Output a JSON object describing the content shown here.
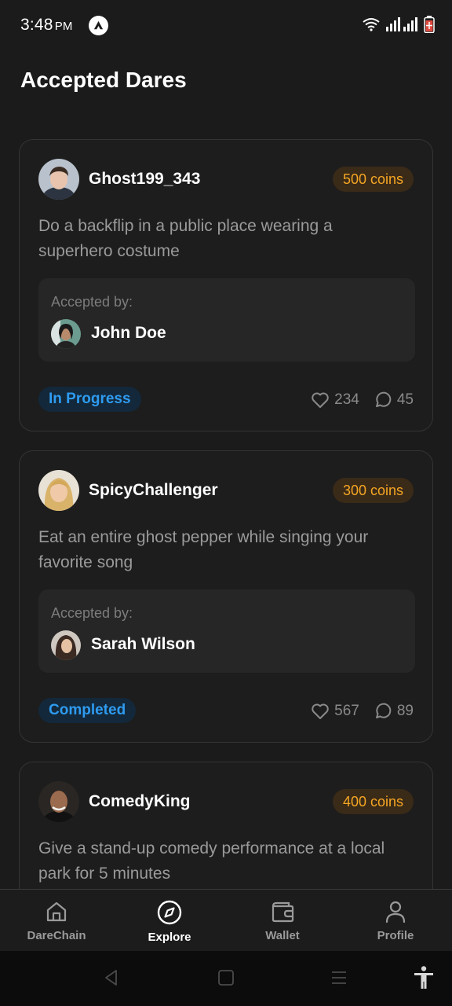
{
  "status_bar": {
    "time": "3:48",
    "ampm": "PM"
  },
  "page_title": "Accepted Dares",
  "cards": [
    {
      "username": "Ghost199_343",
      "coins": "500 coins",
      "description": "Do a backflip in a public place wearing a superhero costume",
      "accepted_label": "Accepted by:",
      "accepted_by": "John Doe",
      "status": "In Progress",
      "likes": "234",
      "comments": "45"
    },
    {
      "username": "SpicyChallenger",
      "coins": "300 coins",
      "description": "Eat an entire ghost pepper while singing your favorite song",
      "accepted_label": "Accepted by:",
      "accepted_by": "Sarah Wilson",
      "status": "Completed",
      "likes": "567",
      "comments": "89"
    },
    {
      "username": "ComedyKing",
      "coins": "400 coins",
      "description": "Give a stand-up comedy performance at a local park for 5 minutes"
    }
  ],
  "bottom_nav": {
    "items": [
      {
        "label": "DareChain",
        "icon": "home-icon"
      },
      {
        "label": "Explore",
        "icon": "compass-icon",
        "active": true
      },
      {
        "label": "Wallet",
        "icon": "wallet-icon"
      },
      {
        "label": "Profile",
        "icon": "user-icon"
      }
    ]
  },
  "colors": {
    "background": "#1b1b1b",
    "coins_text": "#f5a623",
    "status_text": "#2e9bf0"
  }
}
